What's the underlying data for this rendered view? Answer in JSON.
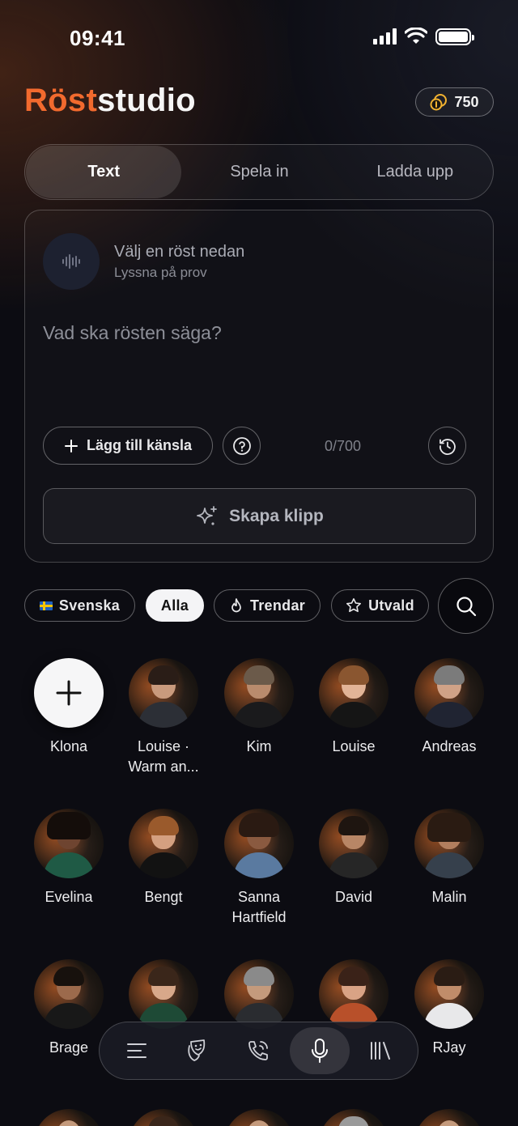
{
  "status_bar": {
    "time": "09:41"
  },
  "header": {
    "brand_part1": "Röst",
    "brand_part2": "studio",
    "credits": "750",
    "accent_color": "#f26a2e"
  },
  "tabs": [
    {
      "label": "Text",
      "active": true
    },
    {
      "label": "Spela in",
      "active": false
    },
    {
      "label": "Ladda upp",
      "active": false
    }
  ],
  "composer": {
    "voice_title": "Välj en röst nedan",
    "voice_subtitle": "Lyssna på prov",
    "prompt_placeholder": "Vad ska rösten säga?",
    "emotion_button": "Lägg till känsla",
    "char_counter": "0/700",
    "create_button": "Skapa klipp"
  },
  "filters": [
    {
      "label": "Svenska",
      "icon": "swedish-flag-icon",
      "active": false
    },
    {
      "label": "Alla",
      "active": true
    },
    {
      "label": "Trendar",
      "icon": "flame-icon",
      "active": false
    },
    {
      "label": "Utvald",
      "icon": "star-icon",
      "active": false
    }
  ],
  "voices": [
    {
      "name": "Klona",
      "type": "clone"
    },
    {
      "name": "Louise · Warm an...",
      "line1": "Louise ·",
      "line2": "Warm an..."
    },
    {
      "name": "Kim"
    },
    {
      "name": "Louise"
    },
    {
      "name": "Andreas"
    },
    {
      "name": "Evelina"
    },
    {
      "name": "Bengt"
    },
    {
      "name": "Sanna Hartfield",
      "line1": "Sanna",
      "line2": "Hartfield"
    },
    {
      "name": "David"
    },
    {
      "name": "Malin"
    },
    {
      "name": "Brage"
    },
    {
      "name": ""
    },
    {
      "name": ""
    },
    {
      "name": ""
    },
    {
      "name": "RJay"
    }
  ],
  "bottom_nav": [
    {
      "icon": "list-icon",
      "active": false
    },
    {
      "icon": "theater-masks-icon",
      "active": false
    },
    {
      "icon": "phone-call-icon",
      "active": false
    },
    {
      "icon": "microphone-icon",
      "active": true
    },
    {
      "icon": "library-icon",
      "active": false
    }
  ]
}
